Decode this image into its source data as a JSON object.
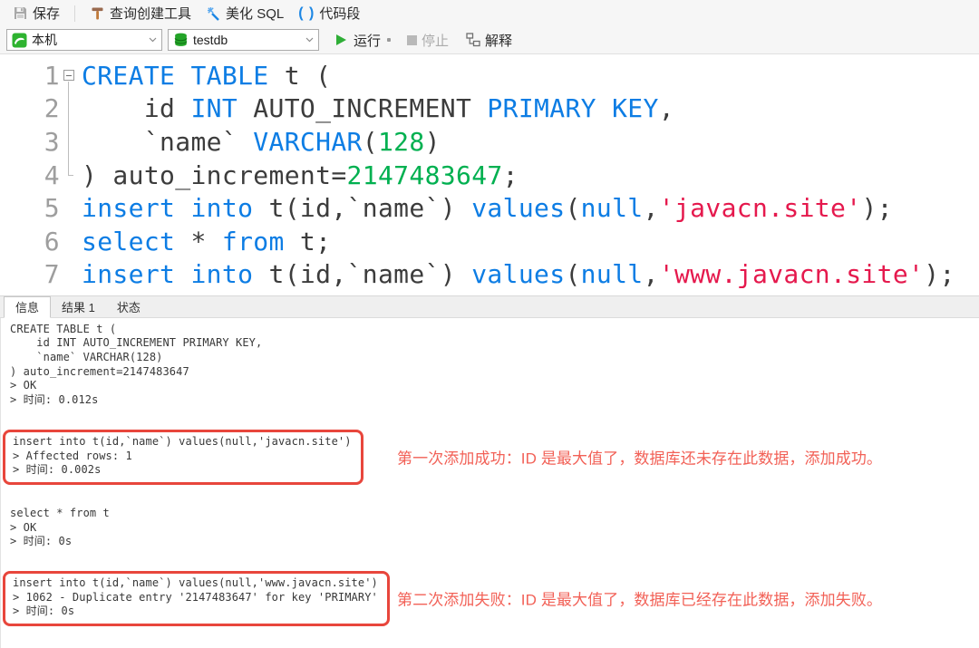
{
  "toolbar": {
    "save": "保存",
    "query_builder": "查询创建工具",
    "beautify_sql": "美化 SQL",
    "code_snippet": "代码段"
  },
  "toolbar2": {
    "connection": "本机",
    "database": "testdb",
    "run": "运行",
    "stop": "停止",
    "explain": "解释"
  },
  "tabs": [
    "信息",
    "结果 1",
    "状态"
  ],
  "editor": {
    "lines": [
      {
        "num": "1",
        "fold": "fold-start",
        "segments": [
          {
            "t": "CREATE TABLE",
            "c": "kw"
          },
          {
            "t": " t (",
            "c": "pl"
          }
        ]
      },
      {
        "num": "2",
        "fold": "fold-mid",
        "segments": [
          {
            "t": "    id ",
            "c": "pl"
          },
          {
            "t": "INT",
            "c": "kw"
          },
          {
            "t": " AUTO_INCREMENT ",
            "c": "pl"
          },
          {
            "t": "PRIMARY KEY",
            "c": "kw"
          },
          {
            "t": ",",
            "c": "pl"
          }
        ]
      },
      {
        "num": "3",
        "fold": "fold-mid",
        "segments": [
          {
            "t": "    `name` ",
            "c": "pl"
          },
          {
            "t": "VARCHAR",
            "c": "kw"
          },
          {
            "t": "(",
            "c": "pl"
          },
          {
            "t": "128",
            "c": "num"
          },
          {
            "t": ")",
            "c": "pl"
          }
        ]
      },
      {
        "num": "4",
        "fold": "fold-end",
        "segments": [
          {
            "t": ") auto_increment=",
            "c": "pl"
          },
          {
            "t": "2147483647",
            "c": "num"
          },
          {
            "t": ";",
            "c": "pl"
          }
        ]
      },
      {
        "num": "5",
        "fold": "",
        "segments": [
          {
            "t": "insert into",
            "c": "kw"
          },
          {
            "t": " t(id,`name`) ",
            "c": "pl"
          },
          {
            "t": "values",
            "c": "kw"
          },
          {
            "t": "(",
            "c": "pl"
          },
          {
            "t": "null",
            "c": "kw"
          },
          {
            "t": ",",
            "c": "pl"
          },
          {
            "t": "'javacn.site'",
            "c": "str"
          },
          {
            "t": ");",
            "c": "pl"
          }
        ]
      },
      {
        "num": "6",
        "fold": "",
        "segments": [
          {
            "t": "select",
            "c": "kw"
          },
          {
            "t": " * ",
            "c": "pl"
          },
          {
            "t": "from",
            "c": "kw"
          },
          {
            "t": " t;",
            "c": "pl"
          }
        ]
      },
      {
        "num": "7",
        "fold": "",
        "segments": [
          {
            "t": "insert into",
            "c": "kw"
          },
          {
            "t": " t(id,`name`) ",
            "c": "pl"
          },
          {
            "t": "values",
            "c": "kw"
          },
          {
            "t": "(",
            "c": "pl"
          },
          {
            "t": "null",
            "c": "kw"
          },
          {
            "t": ",",
            "c": "pl"
          },
          {
            "t": "'www.javacn.site'",
            "c": "str"
          },
          {
            "t": ");",
            "c": "pl"
          }
        ]
      }
    ]
  },
  "output": {
    "blocks": [
      {
        "boxed": false,
        "lines": [
          "CREATE TABLE t (",
          "    id INT AUTO_INCREMENT PRIMARY KEY,",
          "    `name` VARCHAR(128)",
          ") auto_increment=2147483647",
          "> OK",
          "> 时间: 0.012s"
        ]
      },
      {
        "boxed": true,
        "annotation": "第一次添加成功：ID 是最大值了，数据库还未存在此数据，添加成功。",
        "lines": [
          "insert into t(id,`name`) values(null,'javacn.site')",
          "> Affected rows: 1",
          "> 时间: 0.002s"
        ]
      },
      {
        "boxed": false,
        "lines": [
          "select * from t",
          "> OK",
          "> 时间: 0s"
        ]
      },
      {
        "boxed": true,
        "annotation": "第二次添加失败：ID 是最大值了，数据库已经存在此数据，添加失败。",
        "lines": [
          "insert into t(id,`name`) values(null,'www.javacn.site')",
          "> 1062 - Duplicate entry '2147483647' for key 'PRIMARY'",
          "> 时间: 0s"
        ]
      }
    ]
  },
  "colors": {
    "keyword_blue": "#0d7de4",
    "number_green": "#00b050",
    "string_red": "#e5194d",
    "box_border_red": "#e8463c",
    "annotation_red": "#f26157",
    "run_green": "#2fae37"
  }
}
